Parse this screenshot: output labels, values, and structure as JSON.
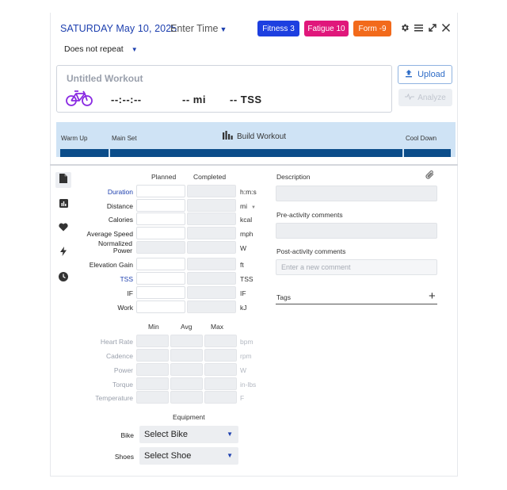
{
  "header": {
    "date": "SATURDAY May 10, 2025",
    "time_placeholder": "Enter Time",
    "badges": {
      "fitness": "Fitness 3",
      "fatigue": "Fatigue 10",
      "form": "Form -9"
    },
    "repeat": "Does not repeat"
  },
  "workout": {
    "title": "Untitled Workout",
    "duration": "--:--:--",
    "distance": "-- mi",
    "tss": "-- TSS",
    "upload_label": "Upload",
    "analyze_label": "Analyze"
  },
  "build_strip": {
    "warm_up": "Warm Up",
    "main_set": "Main Set",
    "build_label": "Build Workout",
    "cool_down": "Cool Down"
  },
  "stats": {
    "planned_header": "Planned",
    "completed_header": "Completed",
    "rows": [
      {
        "label": "Duration",
        "unit": "h:m:s"
      },
      {
        "label": "Distance",
        "unit": "mi"
      },
      {
        "label": "Calories",
        "unit": "kcal"
      },
      {
        "label": "Average Speed",
        "unit": "mph"
      },
      {
        "label": "Normalized Power",
        "unit": "W"
      },
      {
        "label": "Elevation Gain",
        "unit": "ft"
      },
      {
        "label": "TSS",
        "unit": "TSS"
      },
      {
        "label": "IF",
        "unit": "IF"
      },
      {
        "label": "Work",
        "unit": "kJ"
      }
    ]
  },
  "minmax": {
    "min_header": "Min",
    "avg_header": "Avg",
    "max_header": "Max",
    "rows": [
      {
        "label": "Heart Rate",
        "unit": "bpm"
      },
      {
        "label": "Cadence",
        "unit": "rpm"
      },
      {
        "label": "Power",
        "unit": "W"
      },
      {
        "label": "Torque",
        "unit": "in-lbs"
      },
      {
        "label": "Temperature",
        "unit": "F"
      }
    ]
  },
  "equipment": {
    "header": "Equipment",
    "bike_label": "Bike",
    "bike_value": "Select Bike",
    "shoes_label": "Shoes",
    "shoes_value": "Select Shoe"
  },
  "notes": {
    "description_label": "Description",
    "pre_label": "Pre-activity comments",
    "post_label": "Post-activity comments",
    "comment_placeholder": "Enter a new comment",
    "tags_label": "Tags"
  },
  "colors": {
    "accent": "#1e40af",
    "fitness": "#1d3fe0",
    "fatigue": "#e0177b",
    "form": "#f26a1b",
    "bike_icon": "#8a2be2",
    "workout_bar": "#0b4d8a",
    "strip_bg": "#cfe3f5"
  },
  "icons": [
    "gear-icon",
    "menu-icon",
    "expand-icon",
    "close-icon",
    "bike-icon",
    "upload-icon",
    "analyze-icon",
    "build-chart-icon",
    "document-icon",
    "chart-icon",
    "heart-icon",
    "bolt-icon",
    "clock-icon",
    "paperclip-icon",
    "plus-icon"
  ]
}
